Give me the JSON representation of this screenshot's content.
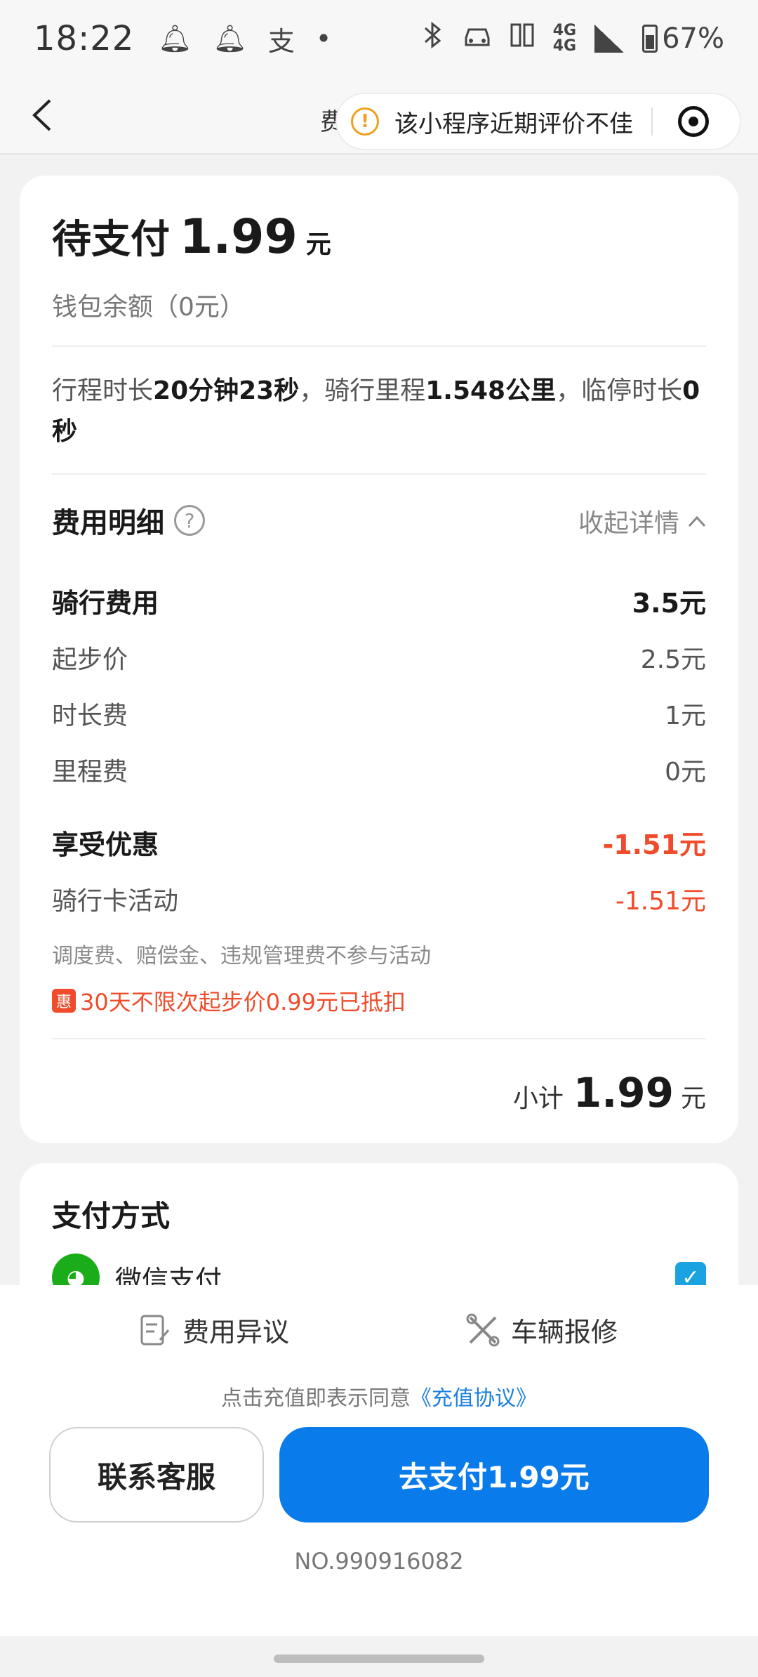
{
  "status_bar": {
    "time": "18:22",
    "icons_left": [
      "bell-icon",
      "bell-icon",
      "alipay-icon",
      "dot-icon"
    ],
    "network_top": "4G",
    "network_bottom": "4G",
    "battery": "67%"
  },
  "nav": {
    "title_peek": "费",
    "warning": "该小程序近期评价不佳"
  },
  "order": {
    "pending_label": "待支付",
    "pending_amount": "1.99",
    "pending_unit": "元",
    "wallet_text": "钱包余额（0元）",
    "trip": {
      "t1": "行程时长",
      "duration": "20分钟23秒",
      "t2": "，骑行里程",
      "distance": "1.548公里",
      "t3": "，临停时长",
      "parking": "0秒"
    }
  },
  "fees": {
    "title": "费用明细",
    "collapse_label": "收起详情",
    "ride_fee": {
      "label": "骑行费用",
      "value": "3.5元"
    },
    "base_price": {
      "label": "起步价",
      "value": "2.5元"
    },
    "time_fee": {
      "label": "时长费",
      "value": "1元"
    },
    "distance_fee": {
      "label": "里程费",
      "value": "0元"
    },
    "discount": {
      "label": "享受优惠",
      "value": "-1.51元"
    },
    "card_activity": {
      "label": "骑行卡活动",
      "value": "-1.51元"
    },
    "note": "调度费、赔偿金、违规管理费不参与活动",
    "promo_badge": "惠",
    "promo_text": "30天不限次起步价0.99元已抵扣",
    "subtotal_label": "小计",
    "subtotal_amount": "1.99",
    "subtotal_unit": "元"
  },
  "payment": {
    "title": "支付方式",
    "method": "微信支付",
    "selected": true
  },
  "bottom": {
    "dispute": "费用异议",
    "repair": "车辆报修",
    "agree_prefix": "点击充值即表示同意",
    "agree_link": "《充值协议》",
    "service_btn": "联系客服",
    "pay_btn": "去支付1.99元",
    "order_no": "NO.990916082"
  },
  "colors": {
    "primary_blue": "#0a7bea",
    "discount_red": "#f04b2a",
    "wechat_green": "#1aad19",
    "warning_orange": "#f0a020"
  }
}
